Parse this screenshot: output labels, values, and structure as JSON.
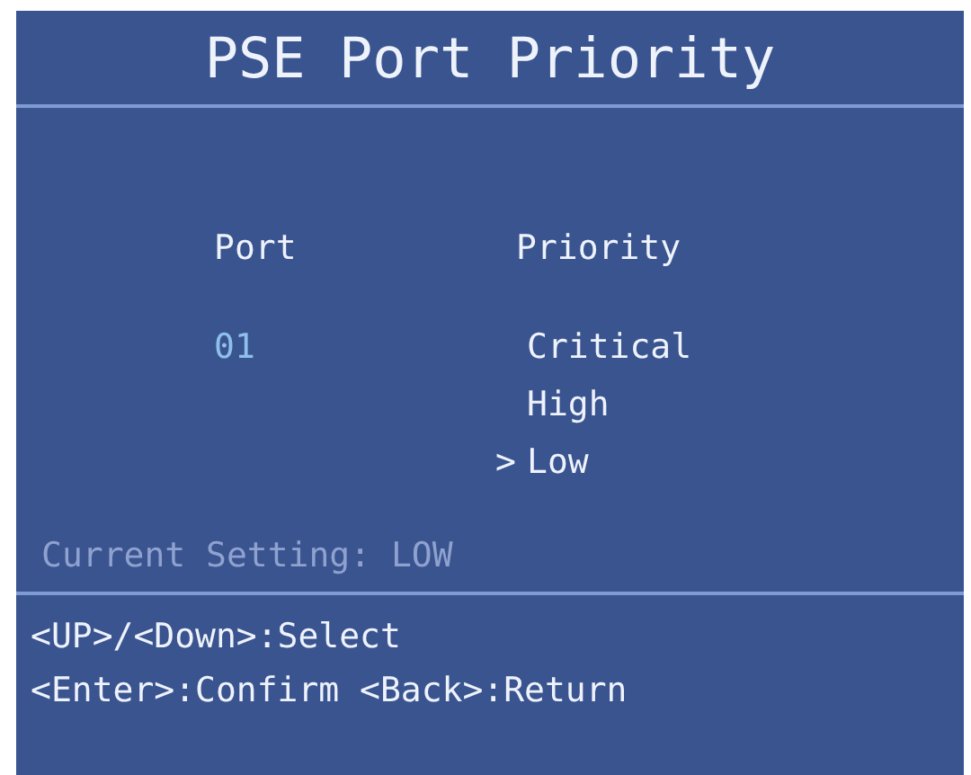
{
  "title": "PSE Port Priority",
  "columns": [
    "Port",
    "Priority"
  ],
  "port": "01",
  "cursor": ">",
  "options": [
    {
      "label": "Critical",
      "selected": false
    },
    {
      "label": "High",
      "selected": false
    },
    {
      "label": "Low",
      "selected": true
    }
  ],
  "current_setting": "Current Setting: LOW",
  "help": [
    "<UP>/<Down>:Select",
    "<Enter>:Confirm <Back>:Return"
  ]
}
